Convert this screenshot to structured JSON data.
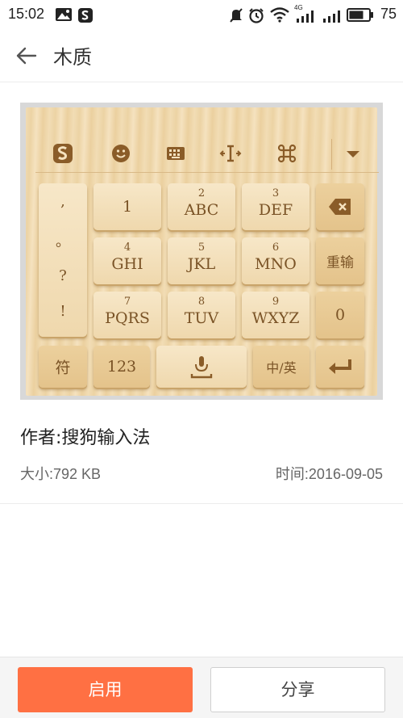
{
  "status_bar": {
    "time": "15:02",
    "network_label": "4G",
    "battery_level": "75"
  },
  "header": {
    "title": "木质"
  },
  "preview": {
    "punctuation": [
      ",",
      "。",
      "?",
      "!"
    ],
    "rows": [
      [
        {
          "num": "",
          "label": "1"
        },
        {
          "num": "2",
          "label": "ABC"
        },
        {
          "num": "3",
          "label": "DEF"
        }
      ],
      [
        {
          "num": "4",
          "label": "GHI"
        },
        {
          "num": "5",
          "label": "JKL"
        },
        {
          "num": "6",
          "label": "MNO"
        }
      ],
      [
        {
          "num": "7",
          "label": "PQRS"
        },
        {
          "num": "8",
          "label": "TUV"
        },
        {
          "num": "9",
          "label": "WXYZ"
        }
      ]
    ],
    "right_keys": {
      "reinput": "重输",
      "zero": "0"
    },
    "bottom_keys": {
      "symbol": "符",
      "numeric": "123",
      "lang": "中/英"
    }
  },
  "info": {
    "author": "作者:搜狗输入法",
    "size": "大小:792 KB",
    "time": "时间:2016-09-05"
  },
  "actions": {
    "enable_label": "启用",
    "share_label": "分享"
  },
  "colors": {
    "accent": "#ff7043",
    "wood_text": "#7a5326"
  }
}
